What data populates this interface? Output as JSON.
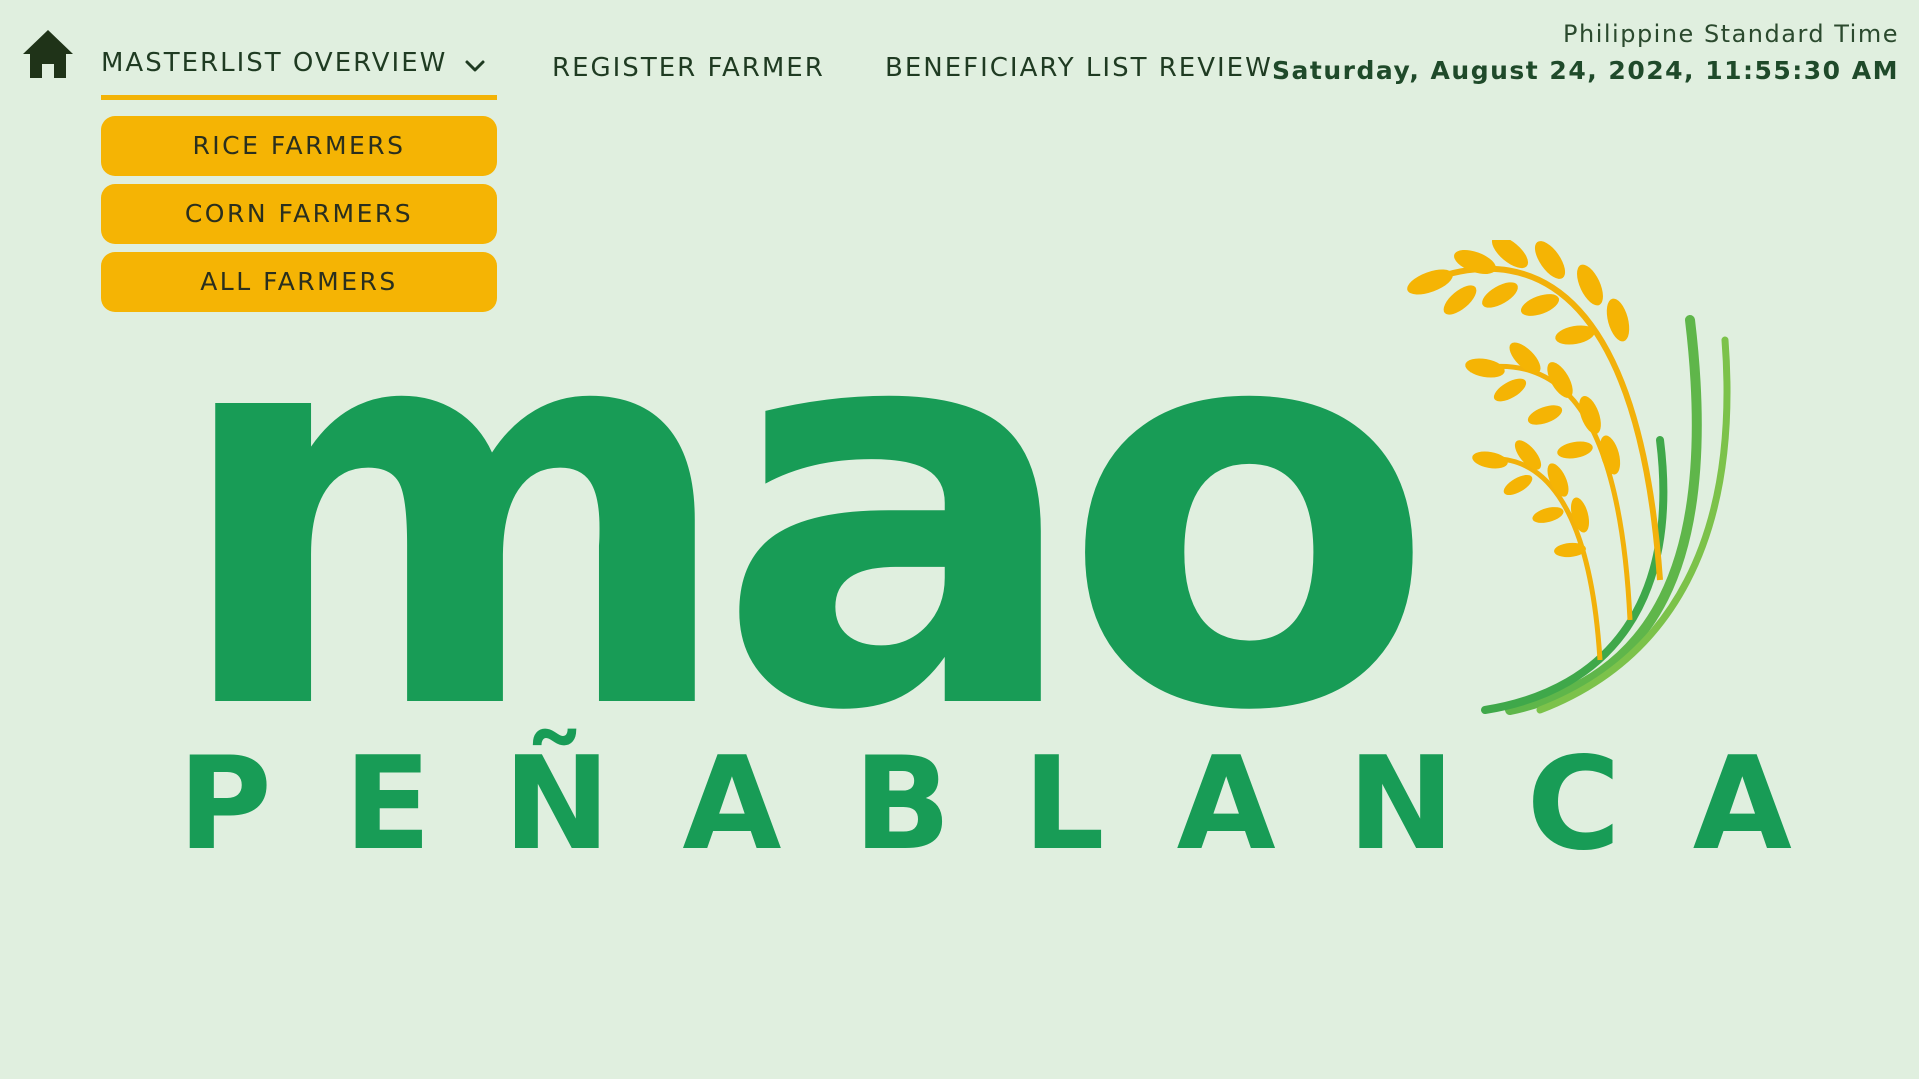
{
  "nav": {
    "home_icon": "home-icon",
    "masterlist_label": "MASTERLIST OVERVIEW",
    "masterlist_chevron_icon": "chevron-down-icon",
    "register_label": "REGISTER FARMER",
    "beneficiary_label": "BENEFICIARY LIST REVIEW"
  },
  "dropdown": {
    "items": [
      "RICE FARMERS",
      "CORN FARMERS",
      "ALL FARMERS"
    ]
  },
  "clock": {
    "timezone_label": "Philippine Standard Time",
    "datetime": "Saturday, August 24, 2024, 11:55:30 AM"
  },
  "logo": {
    "word": "mao",
    "subtitle": "PEÑABLANCA",
    "wheat_icon": "wheat-icon"
  },
  "colors": {
    "background": "#e0efdf",
    "brand_green": "#189c56",
    "accent_yellow": "#f5b404",
    "nav_text": "#1f3b22"
  }
}
